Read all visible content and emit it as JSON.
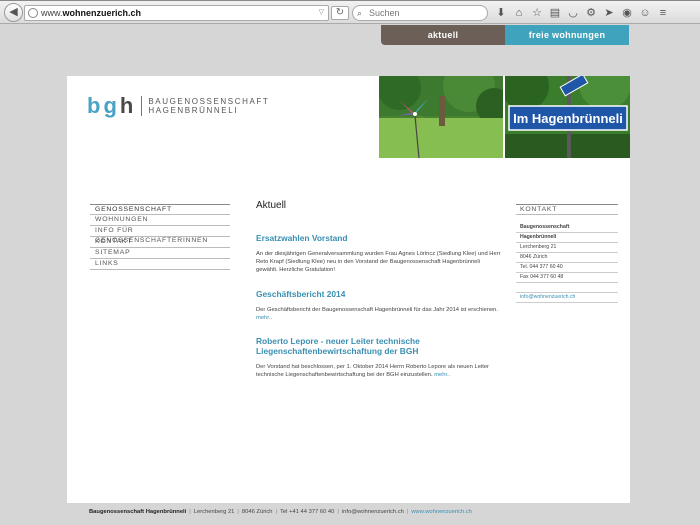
{
  "browser": {
    "url_prefix": "www.",
    "url_domain": "wohnenzuerich.ch",
    "search_placeholder": "Suchen"
  },
  "site_nav": {
    "tab_aktuell": "aktuell",
    "tab_wohnungen": "freie wohnungen"
  },
  "logo": {
    "mark_b": "b",
    "mark_g": "g",
    "mark_h": "h",
    "line1": "BAUGENOSSENSCHAFT",
    "line2": "HAGENBRÜNNELI"
  },
  "photos": {
    "sign_text": "Im Hagenbrünneli"
  },
  "left_menu": [
    {
      "label": "GENOSSENSCHAFT"
    },
    {
      "label": "WOHNUNGEN"
    },
    {
      "label": "INFO FÜR GENOSSENSCHAFTERINNEN"
    },
    {
      "label": "KONTAKT"
    },
    {
      "label": "SITEMAP"
    },
    {
      "label": "LINKS"
    }
  ],
  "main": {
    "heading": "Aktuell",
    "articles": [
      {
        "title": "Ersatzwahlen Vorstand",
        "body": "An der diesjährigen Generalversammlung wurden Frau Agnes Lörincz (Siedlung Klee) und Herr Reto Krapf (Siedlung Klee) neu in den Vorstand der Baugenossenschaft Hagenbrünneli gewählt. Herzliche Gratulation!",
        "more": ""
      },
      {
        "title": "Geschäftsbericht 2014",
        "body": "Der Geschäftsbericht der Baugenossenschaft Hagenbrünneli für das Jahr 2014 ist erschienen.",
        "more": "mehr.."
      },
      {
        "title": "Roberto Lepore - neuer Leiter technische Liegenschaftenbewirtschaftung der BGH",
        "body": "Der Vorstand hat beschlossen, per 1. Oktober 2014 Herrn Roberto Lepore als neuen Leiter technische Liegenschaftenbewirtschaftung bei der BGH einzustellen.",
        "more": "mehr.."
      }
    ]
  },
  "contact": {
    "heading": "KONTAKT",
    "org1": "Baugenossenschaft",
    "org2": "Hagenbrünneli",
    "street": "Lerchenberg 21",
    "city": "8046 Zürich",
    "tel": "Tel. 044 377 60 40",
    "fax": "Fax 044 377 60 48",
    "email": "info@wohnenzuerich.ch"
  },
  "footer": {
    "name": "Baugenossenschaft Hagenbrünneli",
    "street": "Lerchenberg 21",
    "city": "8046 Zürich",
    "tel": "Tel +41 44 377 60 40",
    "email": "info@wohnenzuerich.ch",
    "web": "www.wohnenzuerich.ch"
  }
}
